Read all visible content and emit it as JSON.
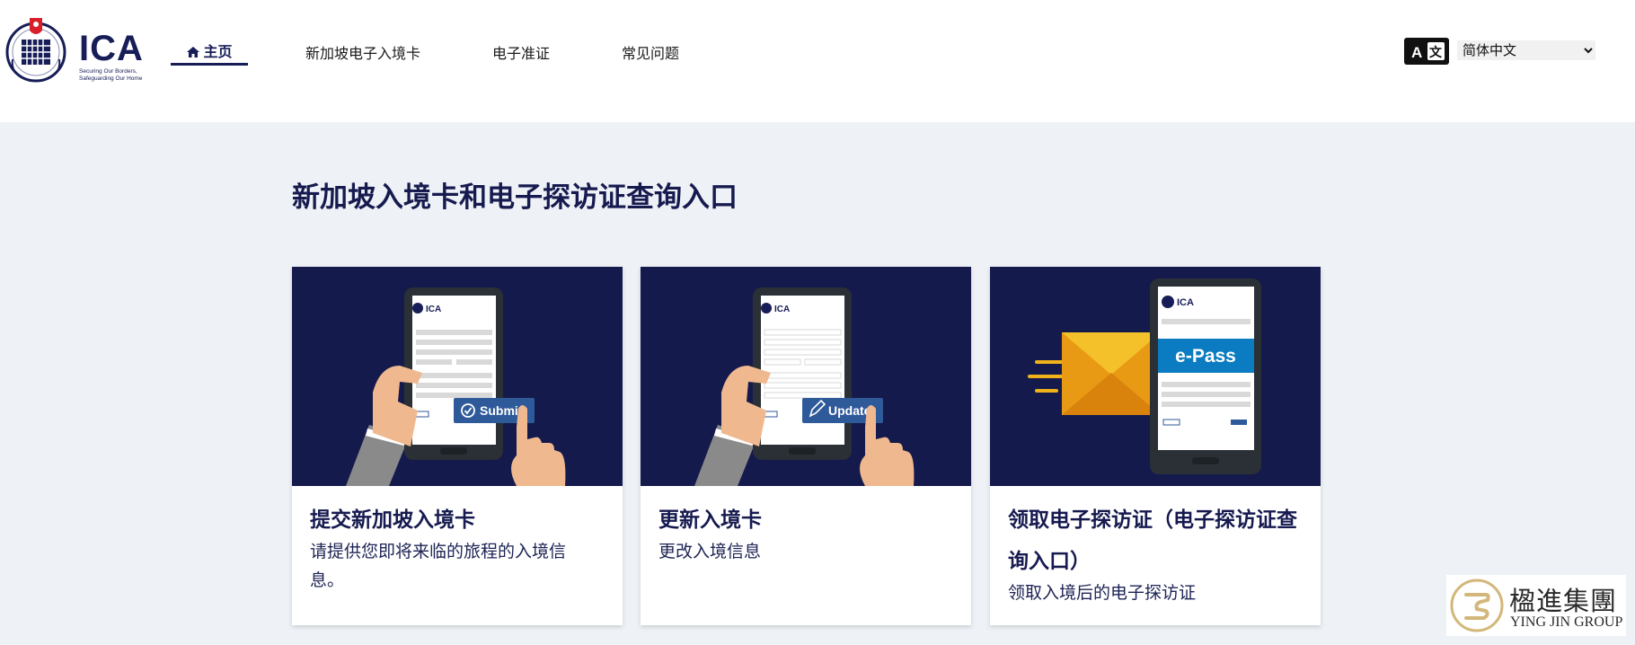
{
  "header": {
    "logo": {
      "text": "ICA",
      "tagline_line1": "Securing Our Borders,",
      "tagline_line2": "Safeguarding Our Home"
    },
    "nav": [
      {
        "label": "主页",
        "icon": "home-icon",
        "active": true
      },
      {
        "label": "新加坡电子入境卡"
      },
      {
        "label": "电子准证"
      },
      {
        "label": "常见问题"
      }
    ],
    "language": {
      "icon": "translate-icon",
      "selected": "简体中文"
    }
  },
  "main": {
    "title": "新加坡入境卡和电子探访证查询入口",
    "cards": [
      {
        "title": "提交新加坡入境卡",
        "description": "请提供您即将来临的旅程的入境信息。",
        "illustration_button": "Submit"
      },
      {
        "title": "更新入境卡",
        "description": "更改入境信息",
        "illustration_button": "Update"
      },
      {
        "title": "领取电子探访证（电子探访证查询入口）",
        "description": "领取入境后的电子探访证",
        "illustration_banner": "e-Pass"
      }
    ]
  },
  "watermark": {
    "cn": "楹進集團",
    "en": "YING JIN GROUP"
  },
  "colors": {
    "navy": "#151a4d",
    "page_bg": "#eef2f6",
    "button_blue": "#2f5a9a",
    "epass_blue": "#0b7cc1",
    "envelope": "#f0b21b",
    "skin": "#f0b88f"
  }
}
